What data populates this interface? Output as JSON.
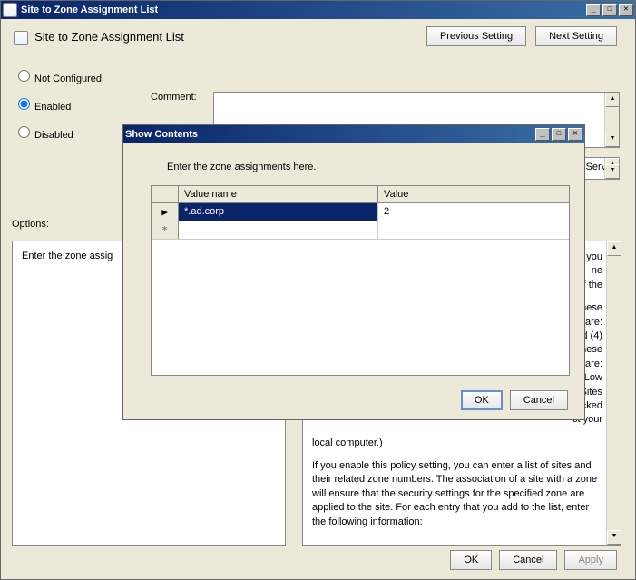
{
  "main": {
    "title": "Site to Zone Assignment List",
    "heading": "Site to Zone Assignment List",
    "prev": "Previous Setting",
    "next": "Next Setting",
    "radios": {
      "not_configured": "Not Configured",
      "enabled": "Enabled",
      "disabled": "Disabled",
      "selected": "enabled"
    },
    "comment_label": "Comment:",
    "server_trailing": "s Server",
    "options_label": "Options:",
    "options_text": "Enter the zone assig",
    "help": {
      "p1a": "t you",
      "p1b": "ne",
      "p1c": "ll of the",
      "p2a": "these",
      "p2b": "They are:",
      "p2c": "and (4)",
      "p2d": "n of these",
      "p2e": "tings are:",
      "p2f": "m-Low",
      "p2g": "ted Sites",
      "p2h": "cked",
      "p2i": "ct your",
      "p3": "local computer.)",
      "p4": "If you enable this policy setting, you can enter a list of sites and their related zone numbers. The association of a site with a zone will ensure that the security settings for the specified zone are applied to the site.  For each entry that you add to the list, enter the following information:"
    },
    "buttons": {
      "ok": "OK",
      "cancel": "Cancel",
      "apply": "Apply"
    }
  },
  "dialog": {
    "title": "Show Contents",
    "prompt": "Enter the zone assignments here.",
    "columns": {
      "value_name": "Value name",
      "value": "Value"
    },
    "rows": [
      {
        "indicator": "▶",
        "name": "*.ad.corp",
        "value": "2",
        "selected": true
      },
      {
        "indicator": "*",
        "name": "",
        "value": "",
        "new": true
      }
    ],
    "buttons": {
      "ok": "OK",
      "cancel": "Cancel"
    }
  }
}
